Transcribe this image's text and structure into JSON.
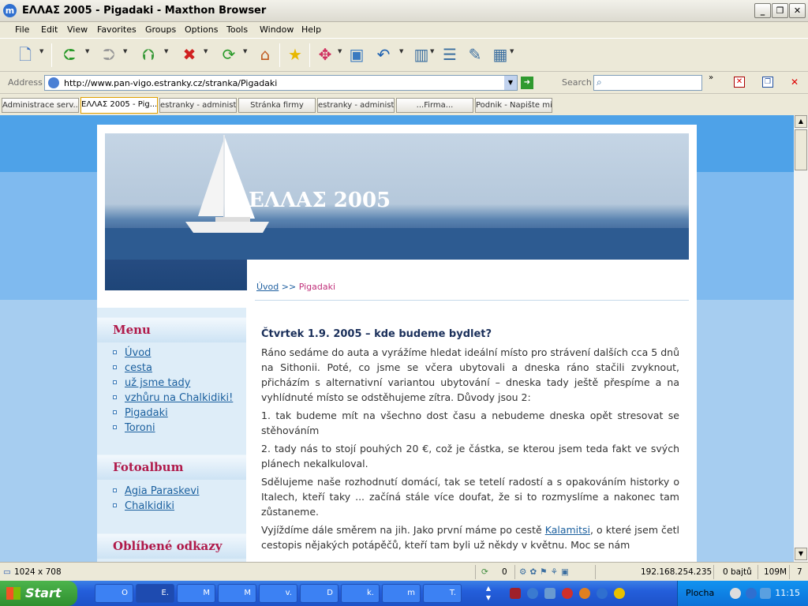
{
  "window": {
    "title": "ΕΛΛΑΣ 2005 - Pigadaki - Maxthon Browser",
    "app_icon": "m"
  },
  "menu": [
    "File",
    "Edit",
    "View",
    "Favorites",
    "Groups",
    "Options",
    "Tools",
    "Window",
    "Help"
  ],
  "address": {
    "label": "Address",
    "url": "http://www.pan-vigo.estranky.cz/stranka/Pigadaki"
  },
  "search": {
    "label": "Search",
    "value": ""
  },
  "tabs": [
    "Administrace serv...",
    "ΕΛΛΑΣ 2005 - Pig...",
    "estranky - administr",
    "Stránka firmy",
    "estranky - administr",
    "...Firma...",
    "Podnik - Napište mi"
  ],
  "site": {
    "header_title": "ΕΛΛΑΣ 2005",
    "breadcrumb": {
      "home": "Úvod",
      "sep": ">>",
      "current": "Pigadaki"
    },
    "sidebar": {
      "menu_title": "Menu",
      "menu_items": [
        "Úvod",
        "cesta",
        "už jsme tady",
        "vzhůru na Chalkidiki!",
        "Pigadaki",
        "Toroni"
      ],
      "photo_title": "Fotoalbum",
      "photo_items": [
        "Agia Paraskevi",
        "Chalkidiki"
      ],
      "links_title": "Oblíbené odkazy"
    },
    "article": {
      "heading": "Čtvrtek 1.9. 2005 – kde budeme bydlet?",
      "p1": "Ráno sedáme do auta a vyrážíme hledat ideální místo pro strávení dalších cca 5 dnů na Sithonii. Poté, co jsme se včera ubytovali a dneska ráno stačili zvyknout, přicházím s alternativní variantou ubytování – dneska tady ještě přespíme a na vyhlídnuté místo se odstěhujeme zítra. Důvody jsou 2:",
      "p2": "1. tak budeme mít na všechno dost času a nebudeme dneska opět stresovat se stěhováním",
      "p3": "2. tady nás to stojí pouhých 20 €, což je částka, se kterou jsem teda fakt ve svých plánech nekalkuloval.",
      "p4": "Sdělujeme naše rozhodnutí domácí, tak se tetelí radostí a s opakováním historky o Italech, kteří taky ... začíná stále více doufat, že si to rozmyslíme a nakonec tam zůstaneme.",
      "p5_before": "Vyjíždíme dále směrem na jih. Jako první máme po cestě ",
      "p5_link": "Kalamitsi",
      "p5_after": ", o které jsem četl cestopis nějakých potápěčů, kteří tam byli už někdy v květnu. Moc se nám"
    }
  },
  "status": {
    "size": "1024 x 708",
    "count": "0",
    "ip": "192.168.254.235",
    "bytes": "0 bajtů",
    "mem": "109M",
    "num": "7"
  },
  "taskbar": {
    "start": "Start",
    "tasks": [
      "O",
      "E.",
      "M",
      "M",
      "v.",
      "D",
      "k.",
      "m",
      "T."
    ],
    "plocha": "Plocha",
    "time": "11:15"
  }
}
